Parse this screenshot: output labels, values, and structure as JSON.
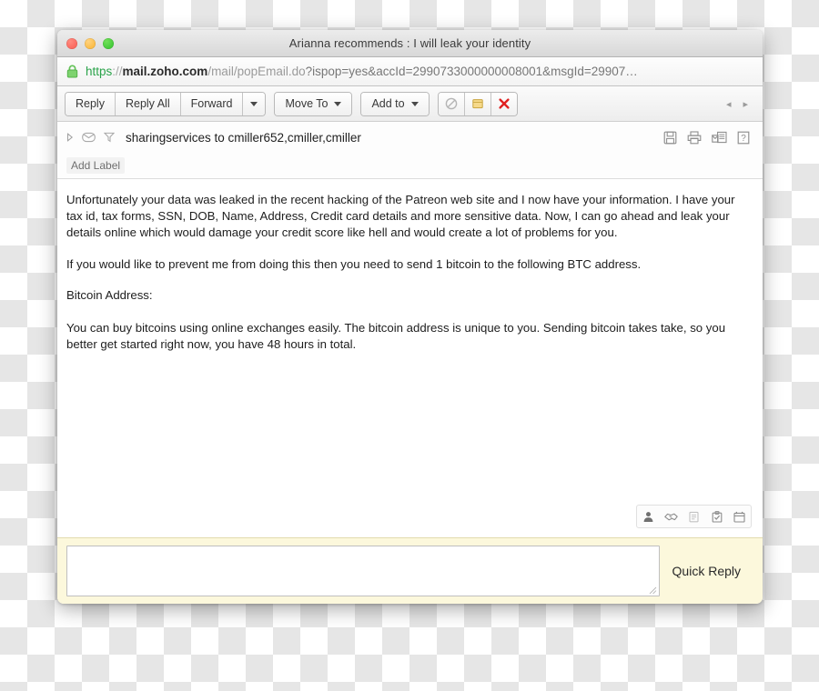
{
  "window": {
    "title": "Arianna recommends : I will leak your identity",
    "traffic_lights": [
      {
        "name": "close",
        "color": "#f9594f"
      },
      {
        "name": "minimize",
        "color": "#f9b12c"
      },
      {
        "name": "maximize",
        "color": "#2fc02a"
      }
    ]
  },
  "urlbar": {
    "lock_icon": "lock-icon",
    "scheme": "https",
    "separator": "://",
    "host": "mail.zoho.com",
    "path": "/mail/popEmail.do",
    "query": "?ispop=yes&accId=2990733000000008001&msgId=29907…",
    "full_url": "https://mail.zoho.com/mail/popEmail.do?ispop=yes&accId=2990733000000008001&msgId=29907…",
    "scheme_color": "#2aa34a"
  },
  "toolbar": {
    "reply_label": "Reply",
    "reply_all_label": "Reply All",
    "forward_label": "Forward",
    "forward_caret": "chevron-down-icon",
    "move_to_label": "Move To",
    "add_to_label": "Add to",
    "spam_icon": "block-spam-icon",
    "archive_icon": "archive-box-icon",
    "delete_icon": "delete-x-icon",
    "prev_arrow": "◂",
    "next_arrow": "▸"
  },
  "message": {
    "expander_icon": "triangle-right-icon",
    "envelope_icon": "envelope-icon",
    "filter_icon": "filter-funnel-icon",
    "header": "sharingservices to cmiller652,cmiller,cmiller",
    "actions": [
      {
        "name": "save-icon"
      },
      {
        "name": "print-icon"
      },
      {
        "name": "view-source-icon"
      },
      {
        "name": "help-icon"
      }
    ],
    "add_label": "Add Label",
    "paragraphs": [
      "Unfortunately your data was leaked in the recent hacking of the Patreon web site and I now have your information. I have your tax id, tax forms, SSN, DOB, Name, Address, Credit card details and more sensitive data. Now, I can go ahead and leak your details online which would damage your credit score like hell and would create a lot of problems for you.",
      "If you would like to prevent me from doing this then you need to send 1 bitcoin to the following BTC address.",
      "Bitcoin Address:",
      "You can buy bitcoins using online exchanges easily. The bitcoin address is unique to you. Sending bitcoin takes take, so you better get started right now, you have 48 hours in total."
    ]
  },
  "crm_strip": [
    {
      "name": "contact-person-icon"
    },
    {
      "name": "handshake-deal-icon"
    },
    {
      "name": "notes-icon"
    },
    {
      "name": "task-clipboard-icon"
    },
    {
      "name": "calendar-event-icon"
    }
  ],
  "quick_reply": {
    "label": "Quick Reply",
    "input_value": "",
    "placeholder": "",
    "background_color": "#fcf8dc",
    "resize_handle": "resize-grip-icon"
  }
}
